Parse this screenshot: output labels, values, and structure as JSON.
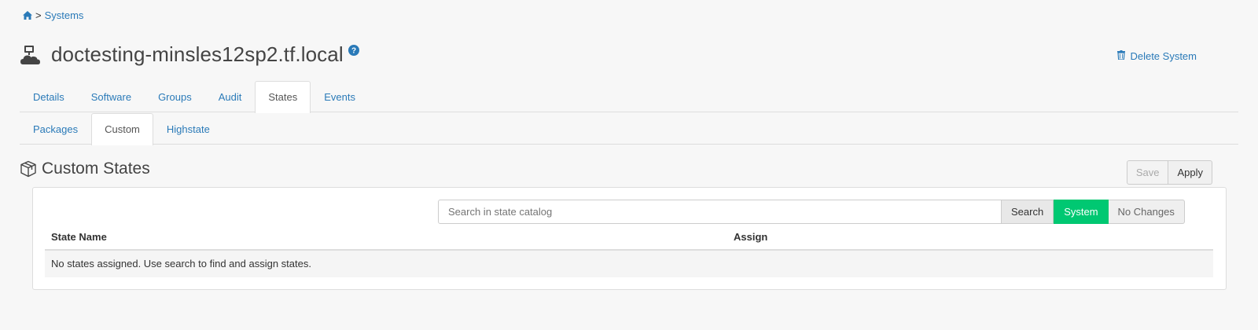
{
  "breadcrumb": {
    "separator": ">",
    "systems_label": "Systems"
  },
  "header": {
    "title": "doctesting-minsles12sp2.tf.local",
    "delete_label": "Delete System"
  },
  "main_tabs": [
    "Details",
    "Software",
    "Groups",
    "Audit",
    "States",
    "Events"
  ],
  "main_active": "States",
  "sub_tabs": [
    "Packages",
    "Custom",
    "Highstate"
  ],
  "sub_active": "Custom",
  "section": {
    "title": "Custom States",
    "save_label": "Save",
    "apply_label": "Apply"
  },
  "search": {
    "placeholder": "Search in state catalog",
    "search_label": "Search",
    "system_label": "System",
    "no_changes_label": "No Changes"
  },
  "table": {
    "col_state_name": "State Name",
    "col_assign": "Assign",
    "empty_message": "No states assigned. Use search to find and assign states."
  },
  "colors": {
    "link": "#2a7ab8",
    "accent_green": "#00c872"
  },
  "icons": {
    "home": "home-icon",
    "system": "system-cloud-icon",
    "help": "help-icon",
    "trash": "trash-icon",
    "states": "cubes-icon"
  }
}
